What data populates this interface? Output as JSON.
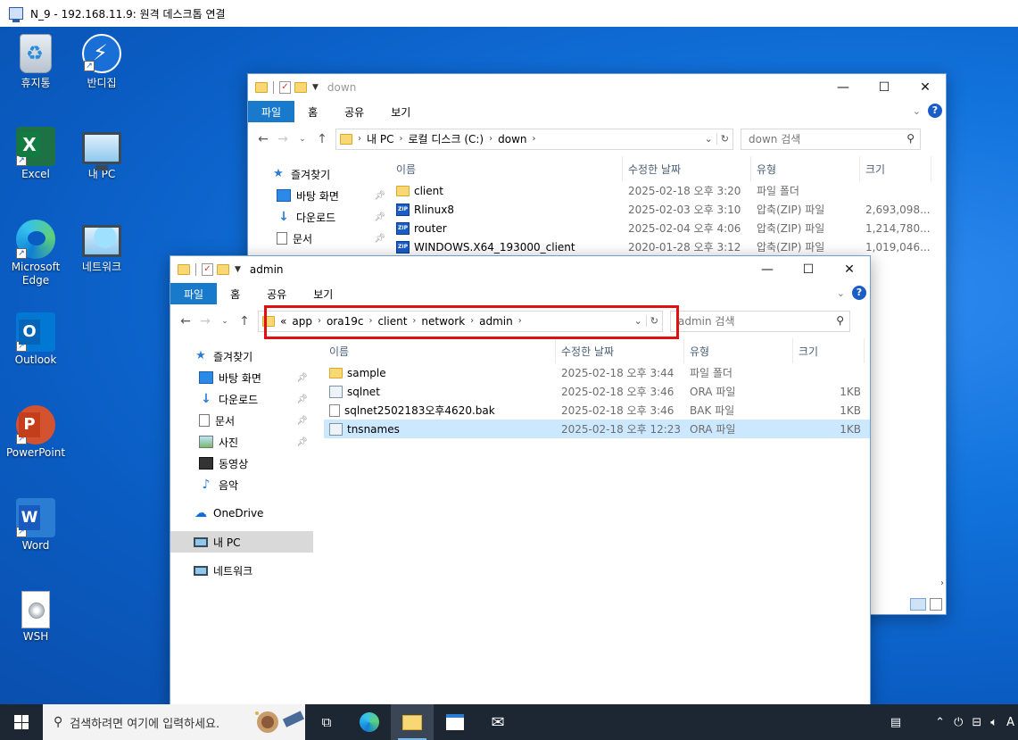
{
  "rdp": {
    "title": "N_9 - 192.168.11.9: 원격 데스크톱 연결"
  },
  "desktop_icons": [
    {
      "label": "휴지통"
    },
    {
      "label": "반디집"
    },
    {
      "label": "Excel"
    },
    {
      "label": "내 PC"
    },
    {
      "label": "Microsoft Edge"
    },
    {
      "label": "네트워크"
    },
    {
      "label": "Outlook"
    },
    {
      "label": "PowerPoint"
    },
    {
      "label": "Word"
    },
    {
      "label": "WSH"
    }
  ],
  "ribbon_tabs": [
    "파일",
    "홈",
    "공유",
    "보기"
  ],
  "back_window": {
    "title": "down",
    "breadcrumb": [
      "내 PC",
      "로컬 디스크 (C:)",
      "down"
    ],
    "search_placeholder": "down 검색",
    "columns": {
      "name": "이름",
      "modified": "수정한 날짜",
      "type": "유형",
      "size": "크기"
    },
    "nav": [
      {
        "label": "즐겨찾기"
      },
      {
        "label": "바탕 화면"
      },
      {
        "label": "다운로드"
      },
      {
        "label": "문서"
      }
    ],
    "files": [
      {
        "name": "client",
        "modified": "2025-02-18 오후 3:20",
        "type": "파일 폴더",
        "size": "",
        "icon": "folder-icon"
      },
      {
        "name": "Rlinux8",
        "modified": "2025-02-03 오후 3:10",
        "type": "압축(ZIP) 파일",
        "size": "2,693,098...",
        "icon": "zip-icon"
      },
      {
        "name": "router",
        "modified": "2025-02-04 오후 4:06",
        "type": "압축(ZIP) 파일",
        "size": "1,214,780...",
        "icon": "zip-icon"
      },
      {
        "name": "WINDOWS.X64_193000_client",
        "modified": "2020-01-28 오후 3:12",
        "type": "압축(ZIP) 파일",
        "size": "1,019,046...",
        "icon": "zip-icon"
      }
    ]
  },
  "front_window": {
    "title": "admin",
    "breadcrumb_prefix": "«",
    "breadcrumb": [
      "app",
      "ora19c",
      "client",
      "network",
      "admin"
    ],
    "search_placeholder": "admin 검색",
    "columns": {
      "name": "이름",
      "modified": "수정한 날짜",
      "type": "유형",
      "size": "크기"
    },
    "nav": [
      {
        "label": "즐겨찾기",
        "icon": "star-icon",
        "pinned": false,
        "indent": 0
      },
      {
        "label": "바탕 화면",
        "icon": "desktop-icon",
        "pinned": true,
        "indent": 1
      },
      {
        "label": "다운로드",
        "icon": "download-icon",
        "pinned": true,
        "indent": 1
      },
      {
        "label": "문서",
        "icon": "document-icon",
        "pinned": true,
        "indent": 1
      },
      {
        "label": "사진",
        "icon": "pictures-icon",
        "pinned": true,
        "indent": 1
      },
      {
        "label": "동영상",
        "icon": "video-icon",
        "pinned": false,
        "indent": 1
      },
      {
        "label": "음악",
        "icon": "music-icon",
        "pinned": false,
        "indent": 1
      },
      {
        "label": "OneDrive",
        "icon": "onedrive-icon",
        "pinned": false,
        "indent": 0
      },
      {
        "label": "내 PC",
        "icon": "computer-icon",
        "pinned": false,
        "indent": 0,
        "selected": true
      },
      {
        "label": "네트워크",
        "icon": "network-icon",
        "pinned": false,
        "indent": 0
      }
    ],
    "files": [
      {
        "name": "sample",
        "modified": "2025-02-18 오후 3:44",
        "type": "파일 폴더",
        "size": "",
        "icon": "folder-icon"
      },
      {
        "name": "sqlnet",
        "modified": "2025-02-18 오후 3:46",
        "type": "ORA 파일",
        "size": "1KB",
        "icon": "ora-file-icon"
      },
      {
        "name": "sqlnet2502183오후4620.bak",
        "modified": "2025-02-18 오후 3:46",
        "type": "BAK 파일",
        "size": "1KB",
        "icon": "bak-file-icon"
      },
      {
        "name": "tnsnames",
        "modified": "2025-02-18 오후 12:23",
        "type": "ORA 파일",
        "size": "1KB",
        "icon": "ora-file-icon",
        "selected": true
      }
    ]
  },
  "taskbar": {
    "search_placeholder": "검색하려면 여기에 입력하세요.",
    "tray_lang": "A"
  },
  "colors": {
    "ribbon_active": "#1979ca",
    "highlight_box": "#e01010",
    "selected_row": "#cce8ff",
    "taskbar": "#1d2633"
  }
}
